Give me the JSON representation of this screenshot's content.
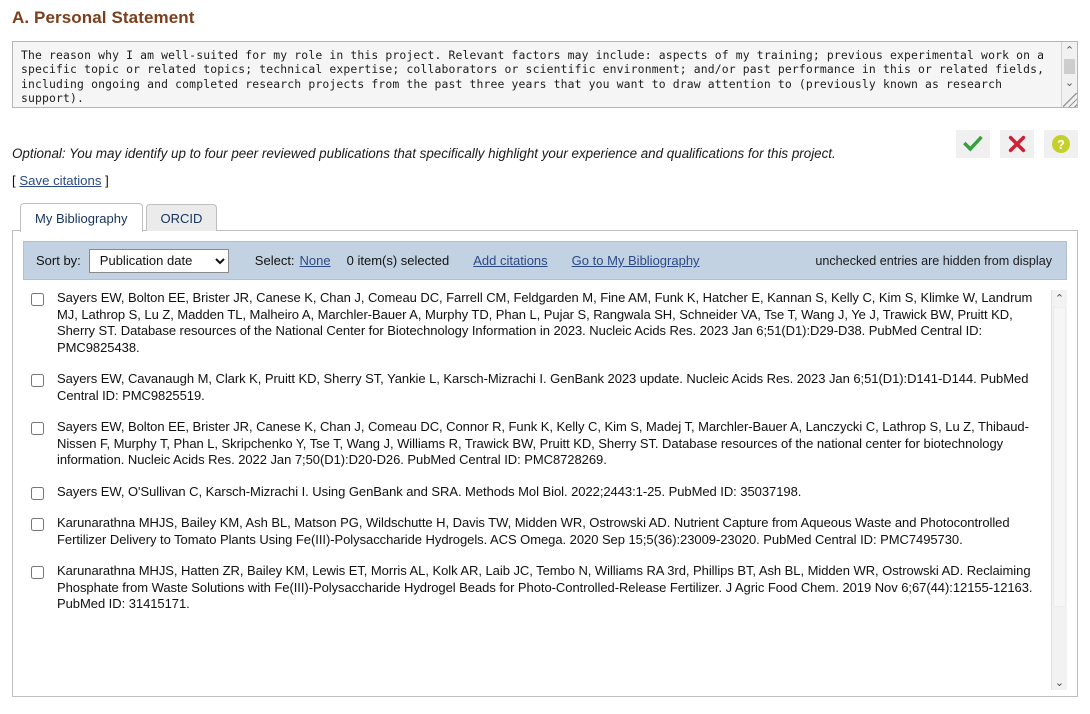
{
  "section": {
    "title": "A. Personal Statement"
  },
  "personal_statement": {
    "value": "The reason why I am well-suited for my role in this project. Relevant factors may include: aspects of my training; previous experimental work on a specific topic or related topics; technical expertise; collaborators or scientific environment; and/or past performance in this or related fields, including ongoing and completed research projects from the past three years that you want to draw attention to (previously known as research support)."
  },
  "actions": {
    "accept": {
      "name": "accept-icon",
      "glyph": "✔",
      "color": "#36a13a",
      "title": "Accept"
    },
    "cancel": {
      "name": "cancel-icon",
      "glyph": "✖",
      "color": "#cf2136",
      "title": "Cancel"
    },
    "help": {
      "name": "help-icon",
      "glyph": "?",
      "color": "#c5d12a",
      "title": "Help"
    }
  },
  "optional_note": "Optional: You may identify up to four peer reviewed publications that specifically highlight your experience and qualifications for this project.",
  "save_citations": {
    "open_bracket": "[",
    "label": "Save citations",
    "close_bracket": "]"
  },
  "tabs": [
    {
      "label": "My Bibliography",
      "active": true
    },
    {
      "label": "ORCID",
      "active": false
    }
  ],
  "toolbar": {
    "sort_label": "Sort by:",
    "sort_value": "Publication date",
    "sort_options": [
      "Publication date"
    ],
    "select_label": "Select:",
    "select_none": "None",
    "selected_count": "0 item(s) selected",
    "add_citations": "Add citations",
    "go_to_my_bibliography": "Go to My Bibliography",
    "hidden_note": "unchecked entries are hidden from display"
  },
  "citations": [
    {
      "checked": false,
      "text": "Sayers EW, Bolton EE, Brister JR, Canese K, Chan J, Comeau DC, Farrell CM, Feldgarden M, Fine AM, Funk K, Hatcher E, Kannan S, Kelly C, Kim S, Klimke W, Landrum MJ, Lathrop S, Lu Z, Madden TL, Malheiro A, Marchler-Bauer A, Murphy TD, Phan L, Pujar S, Rangwala SH, Schneider VA, Tse T, Wang J, Ye J, Trawick BW, Pruitt KD, Sherry ST. Database resources of the National Center for Biotechnology Information in 2023. Nucleic Acids Res. 2023 Jan 6;51(D1):D29-D38. PubMed Central ID: PMC9825438."
    },
    {
      "checked": false,
      "text": "Sayers EW, Cavanaugh M, Clark K, Pruitt KD, Sherry ST, Yankie L, Karsch-Mizrachi I. GenBank 2023 update. Nucleic Acids Res. 2023 Jan 6;51(D1):D141-D144. PubMed Central ID: PMC9825519."
    },
    {
      "checked": false,
      "text": "Sayers EW, Bolton EE, Brister JR, Canese K, Chan J, Comeau DC, Connor R, Funk K, Kelly C, Kim S, Madej T, Marchler-Bauer A, Lanczycki C, Lathrop S, Lu Z, Thibaud-Nissen F, Murphy T, Phan L, Skripchenko Y, Tse T, Wang J, Williams R, Trawick BW, Pruitt KD, Sherry ST. Database resources of the national center for biotechnology information. Nucleic Acids Res. 2022 Jan 7;50(D1):D20-D26. PubMed Central ID: PMC8728269."
    },
    {
      "checked": false,
      "text": "Sayers EW, O'Sullivan C, Karsch-Mizrachi I. Using GenBank and SRA. Methods Mol Biol. 2022;2443:1-25. PubMed ID: 35037198."
    },
    {
      "checked": false,
      "text": "Karunarathna MHJS, Bailey KM, Ash BL, Matson PG, Wildschutte H, Davis TW, Midden WR, Ostrowski AD. Nutrient Capture from Aqueous Waste and Photocontrolled Fertilizer Delivery to Tomato Plants Using Fe(III)-Polysaccharide Hydrogels. ACS Omega. 2020 Sep 15;5(36):23009-23020. PubMed Central ID: PMC7495730."
    },
    {
      "checked": false,
      "text": "Karunarathna MHJS, Hatten ZR, Bailey KM, Lewis ET, Morris AL, Kolk AR, Laib JC, Tembo N, Williams RA 3rd, Phillips BT, Ash BL, Midden WR, Ostrowski AD. Reclaiming Phosphate from Waste Solutions with Fe(III)-Polysaccharide Hydrogel Beads for Photo-Controlled-Release Fertilizer. J Agric Food Chem. 2019 Nov 6;67(44):12155-12163. PubMed ID: 31415171."
    }
  ],
  "scrollbars": {
    "up_glyph": "⌃",
    "down_glyph": "⌄"
  }
}
